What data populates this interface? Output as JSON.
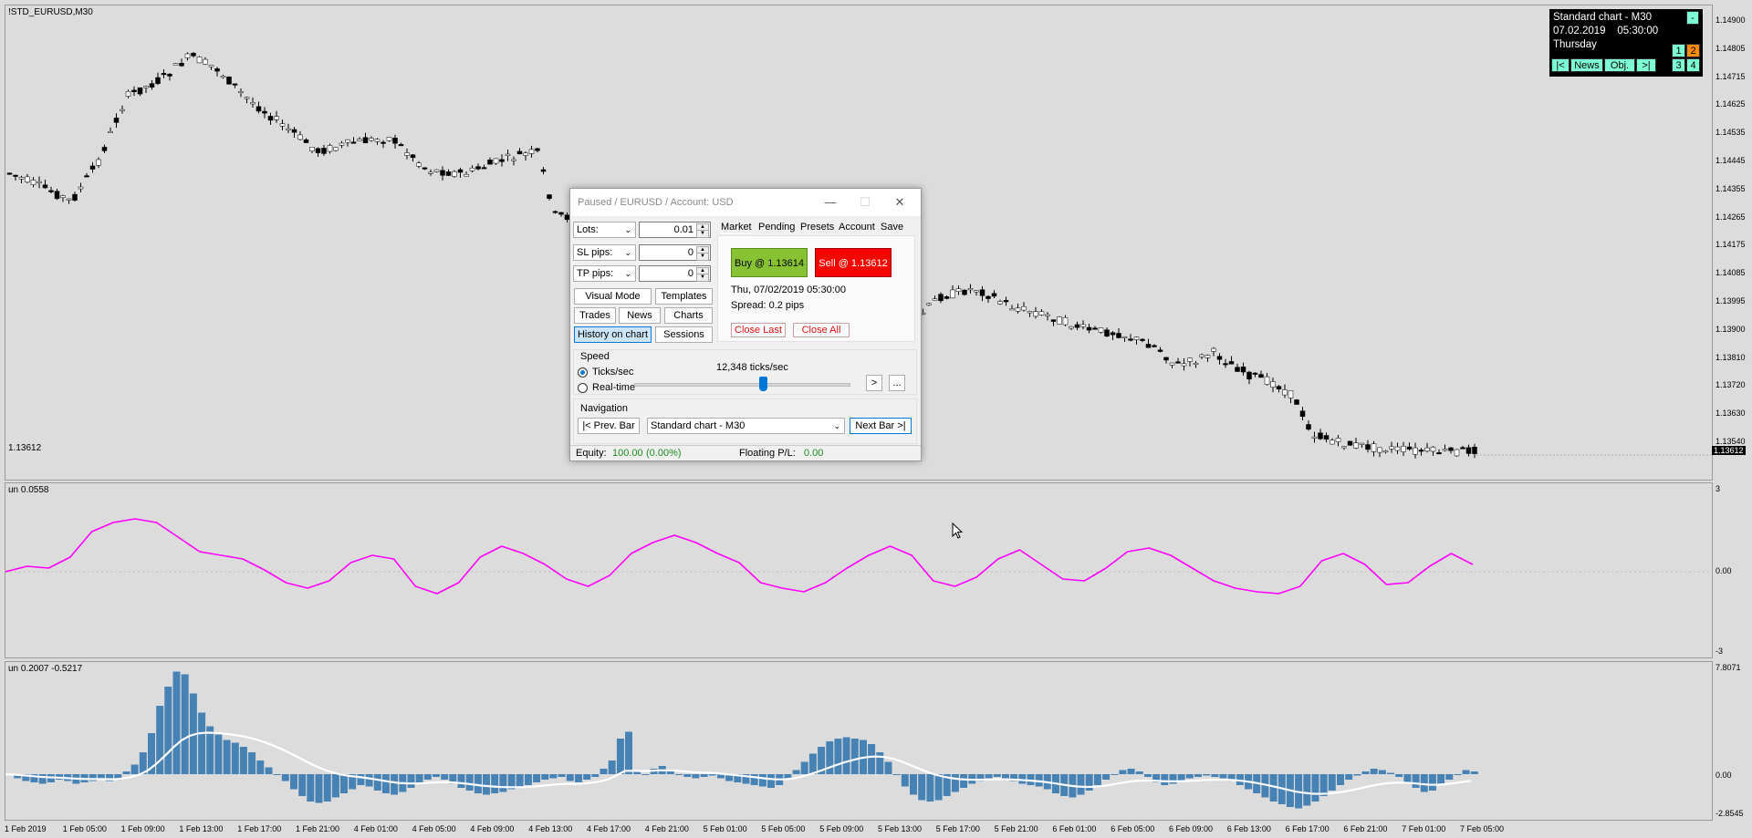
{
  "main_chart": {
    "title": "!STD_EURUSD,M30",
    "current_price_label": "1.13612",
    "price_tag": "1.13612",
    "y_axis": [
      "1.14900",
      "1.14805",
      "1.14715",
      "1.14625",
      "1.14535",
      "1.14445",
      "1.14355",
      "1.14265",
      "1.14175",
      "1.14085",
      "1.13995",
      "1.13900",
      "1.13810",
      "1.13720",
      "1.13630",
      "1.13540"
    ],
    "bull_color": "#ffffff",
    "bear_color": "#000000"
  },
  "osc1": {
    "label": "un 0.0558",
    "y_axis": [
      "3",
      "0.00",
      "-3"
    ],
    "line_color": "#ff00ff",
    "values": [
      0,
      0.3,
      0.2,
      0.8,
      2.2,
      2.7,
      2.9,
      2.7,
      1.9,
      1.1,
      0.9,
      0.7,
      0.1,
      -0.6,
      -0.9,
      -0.5,
      0.5,
      0.9,
      0.7,
      -0.8,
      -1.2,
      -0.6,
      0.8,
      1.4,
      1.0,
      0.4,
      -0.4,
      -0.8,
      -0.2,
      1.0,
      1.6,
      2.0,
      1.6,
      1.0,
      0.5,
      -0.6,
      -0.9,
      -1.1,
      -0.6,
      0.2,
      0.9,
      1.4,
      0.9,
      -0.5,
      -0.8,
      -0.3,
      0.7,
      1.2,
      0.4,
      -0.4,
      -0.5,
      0.2,
      1.1,
      1.3,
      0.9,
      0.2,
      -0.5,
      -0.9,
      -1.1,
      -1.2,
      -0.8,
      0.6,
      1.0,
      0.4,
      -0.7,
      -0.6,
      0.3,
      1.0,
      0.4
    ]
  },
  "osc2": {
    "label": "un 0.2007 -0.5217",
    "y_axis": [
      "7.8071",
      "0.00",
      "-2.8545"
    ],
    "bar_color": "#4682b4",
    "line_color": "#ffffff",
    "values": [
      0.0,
      -0.3,
      -0.5,
      -0.6,
      -0.7,
      -0.6,
      -0.4,
      -0.5,
      -0.7,
      -0.6,
      -0.5,
      -0.3,
      -0.5,
      -0.4,
      0.2,
      0.7,
      1.6,
      3.0,
      5.0,
      6.4,
      7.5,
      7.3,
      5.9,
      4.5,
      3.5,
      2.9,
      2.5,
      2.3,
      2.0,
      1.6,
      1.0,
      0.5,
      0.0,
      -0.5,
      -1.1,
      -1.6,
      -2.0,
      -2.1,
      -2.0,
      -1.7,
      -1.4,
      -1.1,
      -0.8,
      -0.9,
      -1.2,
      -1.4,
      -1.5,
      -1.3,
      -1.0,
      -0.7,
      -0.4,
      -0.2,
      -0.4,
      -0.7,
      -1.0,
      -1.2,
      -1.4,
      -1.5,
      -1.4,
      -1.3,
      -1.1,
      -1.0,
      -0.8,
      -0.6,
      -0.4,
      -0.3,
      -0.2,
      -0.5,
      -0.6,
      -0.4,
      -0.2,
      0.4,
      1.0,
      2.6,
      3.1,
      0.3,
      0.0,
      0.4,
      0.6,
      0.3,
      0.0,
      -0.2,
      -0.3,
      -0.2,
      -0.1,
      -0.3,
      -0.5,
      -0.6,
      -0.7,
      -0.8,
      -0.9,
      -1.0,
      -0.8,
      -0.4,
      0.3,
      0.9,
      1.5,
      2.0,
      2.4,
      2.6,
      2.7,
      2.6,
      2.5,
      2.2,
      1.6,
      0.9,
      0.0,
      -0.9,
      -1.5,
      -1.9,
      -2.0,
      -1.9,
      -1.6,
      -1.3,
      -1.0,
      -0.7,
      -0.5,
      -0.3,
      -0.2,
      -0.3,
      -0.5,
      -0.7,
      -0.8,
      -0.9,
      -1.1,
      -1.4,
      -1.6,
      -1.7,
      -1.5,
      -1.2,
      -0.8,
      -0.4,
      0.0,
      0.3,
      0.4,
      0.2,
      -0.2,
      -0.6,
      -0.8,
      -0.7,
      -0.5,
      -0.3,
      -0.2,
      -0.1,
      -0.2,
      -0.3,
      -0.5,
      -0.8,
      -1.1,
      -1.4,
      -1.7,
      -2.0,
      -2.2,
      -2.4,
      -2.5,
      -2.3,
      -2.0,
      -1.6,
      -1.2,
      -0.8,
      -0.4,
      -0.1,
      0.2,
      0.4,
      0.3,
      0.1,
      -0.2,
      -0.6,
      -1.0,
      -1.3,
      -1.2,
      -0.8,
      -0.4,
      0.0,
      0.3,
      0.2
    ]
  },
  "x_axis": [
    "1 Feb 2019",
    "1 Feb 05:00",
    "1 Feb 09:00",
    "1 Feb 13:00",
    "1 Feb 17:00",
    "1 Feb 21:00",
    "4 Feb 01:00",
    "4 Feb 05:00",
    "4 Feb 09:00",
    "4 Feb 13:00",
    "4 Feb 17:00",
    "4 Feb 21:00",
    "5 Feb 01:00",
    "5 Feb 05:00",
    "5 Feb 09:00",
    "5 Feb 13:00",
    "5 Feb 17:00",
    "5 Feb 21:00",
    "6 Feb 01:00",
    "6 Feb 05:00",
    "6 Feb 09:00",
    "6 Feb 13:00",
    "6 Feb 17:00",
    "6 Feb 21:00",
    "7 Feb 01:00",
    "7 Feb 05:00"
  ],
  "info_box": {
    "title": "Standard chart - M30",
    "date": "07.02.2019",
    "time": "05:30:00",
    "day": "Thursday",
    "minimize": "-",
    "btn_first": "|<",
    "btn_news": "News",
    "btn_obj": "Obj.",
    "btn_last": ">|",
    "n1": "1",
    "n2": "2",
    "n3": "3",
    "n4": "4"
  },
  "dialog": {
    "title": "Paused / EURUSD / Account: USD",
    "lots_label": "Lots:",
    "lots_value": "0.01",
    "sl_label": "SL pips:",
    "sl_value": "0",
    "tp_label": "TP pips:",
    "tp_value": "0",
    "visual_mode": "Visual Mode",
    "templates": "Templates",
    "trades": "Trades",
    "news": "News",
    "charts": "Charts",
    "history_on_chart": "History on chart",
    "sessions": "Sessions",
    "tabs": [
      "Market",
      "Pending",
      "Presets",
      "Account",
      "Save"
    ],
    "buy": "Buy @ 1.13614",
    "sell": "Sell @ 1.13612",
    "datetime": "Thu, 07/02/2019  05:30:00",
    "spread": "Spread:  0.2 pips",
    "close_last": "Close Last",
    "close_all": "Close All",
    "speed_label": "Speed",
    "ticks_radio": "Ticks/sec",
    "realtime_radio": "Real-time",
    "speed_value": "12,348 ticks/sec",
    "speed_slider": 0.6,
    "play": ">",
    "more": "...",
    "navigation_label": "Navigation",
    "prev_bar": "|< Prev. Bar",
    "template_select": "Standard chart - M30",
    "next_bar": "Next Bar >|",
    "equity_label": "Equity:",
    "equity_value": "100.00",
    "equity_pct": "(0.00%)",
    "floating_label": "Floating P/L:",
    "floating_value": "0.00"
  }
}
